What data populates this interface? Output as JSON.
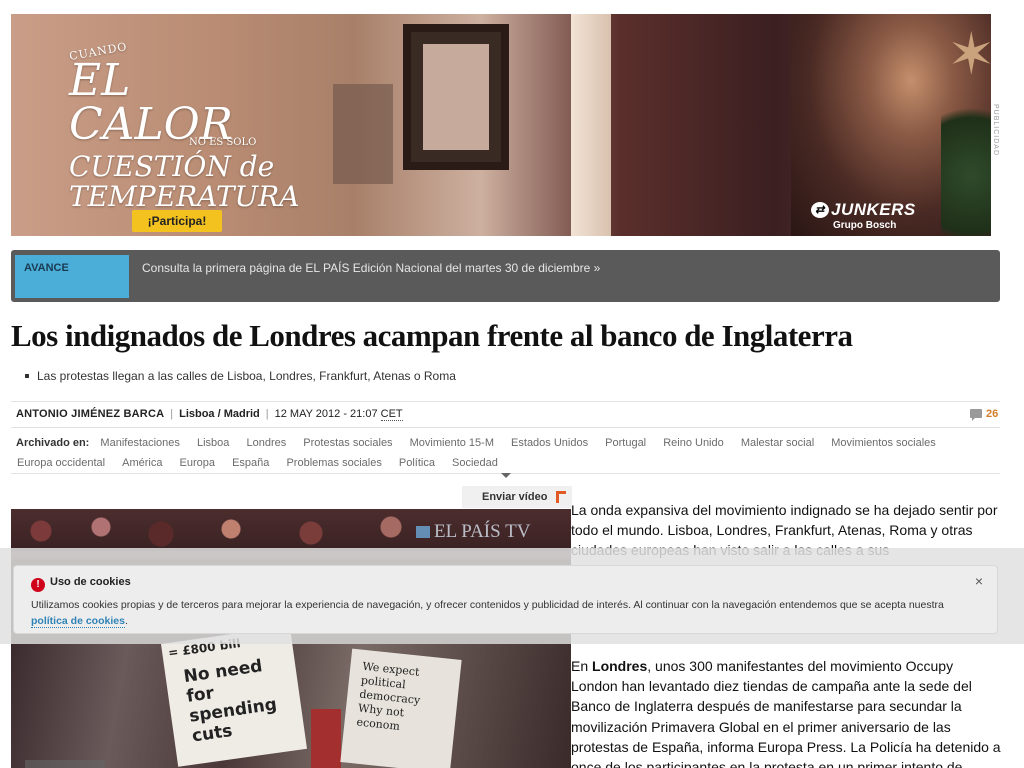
{
  "ad": {
    "small_line1": "CUANDO",
    "big_line1": "EL CALOR",
    "small_line2": "NO ES SOLO",
    "big_line2": "CUESTIÓN de",
    "big_line3": "TEMPERATURA",
    "cta_label": "¡Participa!",
    "brand_name": "JUNKERS",
    "brand_sub": "Grupo Bosch",
    "side_label": "PUBLICIDAD",
    "colors": {
      "cta_bg": "#f3c21f"
    }
  },
  "avance": {
    "badge": "AVANCE",
    "link_text": "Consulta la primera página de EL PAÍS Edición Nacional del martes 30 de diciembre »",
    "colors": {
      "bar_bg": "#5a5a5a",
      "badge_bg": "#4aaed8"
    }
  },
  "article": {
    "headline": "Los indignados de Londres acampan frente al banco de Inglaterra",
    "subhead": "Las protestas llegan a las calles de Lisboa, Londres, Frankfurt, Atenas o Roma",
    "author": "ANTONIO JIMÉNEZ BARCA",
    "location": "Lisboa / Madrid",
    "date": "12 MAY 2012 - 21:07",
    "timezone": "CET",
    "comments_count": "26",
    "tags_label": "Archivado en:",
    "tags": [
      "Manifestaciones",
      "Lisboa",
      "Londres",
      "Protestas sociales",
      "Movimiento 15-M",
      "Estados Unidos",
      "Portugal",
      "Reino Unido",
      "Malestar social",
      "Movimientos sociales",
      "Europa occidental",
      "América",
      "Europa",
      "España",
      "Problemas sociales",
      "Política",
      "Sociedad"
    ],
    "send_video_label": "Enviar vídeo",
    "video_logo": "EL PAÍS TV",
    "p1_text": "La onda expansiva del movimiento indignado se ha dejado sentir por todo el mundo. Lisboa, Londres, Frankfurt, Atenas, Roma y otras ciudades europeas han visto salir a las calles a sus",
    "p2_prefix": "En ",
    "p2_bold": "Londres",
    "p2_rest": ", unos 300 manifestantes del movimiento Occupy London han levantado diez tiendas de campaña ante la sede del Banco de Inglaterra después de manifestarse para secundar la movilización Primavera Global en el primer aniversario de las protestas de España, informa Europa Press. La Policía ha detenido a once de los participantes en la protesta en un primer intento de"
  },
  "video_signs": {
    "sign1_top": "= £800 bill",
    "sign1_text": "No need for spending cuts",
    "sign2_text": "We expect political democracy Why not econom"
  },
  "cookie": {
    "title": "Uso de cookies",
    "text": "Utilizamos cookies propias y de terceros para mejorar la experiencia de navegación, y ofrecer contenidos y publicidad de interés. Al continuar con la navegación entendemos que se acepta nuestra ",
    "link_text": "política de cookies",
    "text_end": ".",
    "close_symbol": "×"
  }
}
